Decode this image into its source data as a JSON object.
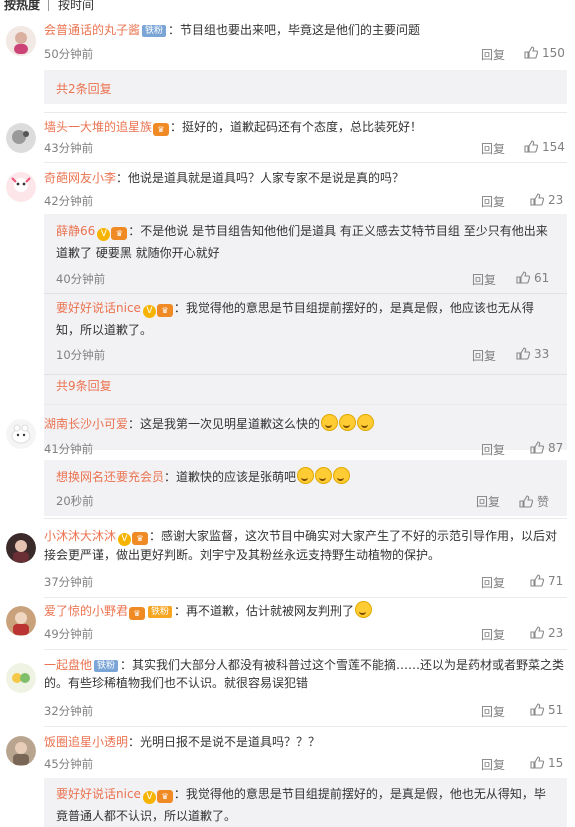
{
  "tabs": [
    "按热度",
    "按时间"
  ],
  "labels": {
    "reply": "回复",
    "like_zero": "赞"
  },
  "comments": [
    {
      "name": "会普通话的丸子酱",
      "badge": "铁粉",
      "text": "：节目组也要出来吧，毕竟这是他们的主要问题",
      "time": "50分钟前",
      "likes": "150",
      "more": "共2条回复"
    },
    {
      "name": "墙头一大堆的追星族",
      "text": "：挺好的，道歉起码还有个态度，总比装死好！",
      "time": "43分钟前",
      "likes": "154"
    },
    {
      "name": "奇葩网友小李",
      "text": "：他说是道具就是道具吗？人家专家不是说是真的吗？",
      "time": "42分钟前",
      "likes": "23",
      "subs": [
        {
          "name": "薛静66",
          "text": "：不是他说 是节目组告知他他们是道具 有正义感去艾特节目组 至少只有他出来道歉了 硬要黑 就随你开心就好",
          "time": "40分钟前",
          "likes": "61"
        },
        {
          "name": "要好好说话nice",
          "text": "：我觉得他的意思是节目组提前摆好的，是真是假，他应该也无从得知，所以道歉了。",
          "time": "10分钟前",
          "likes": "33"
        }
      ],
      "more": "共9条回复"
    },
    {
      "name": "湖南长沙小可爱",
      "text": "：这是我第一次见明星道歉这么快的",
      "time": "41分钟前",
      "likes": "87",
      "subs": [
        {
          "name": "想换网名还要充会员",
          "text": "：道歉快的应该是张萌吧",
          "time": "20秒前",
          "likes": "赞"
        }
      ]
    },
    {
      "name": "小沐沐大沐沐",
      "text": "：感谢大家监督，这次节目中确实对大家产生了不好的示范引导作用，以后对接会更严谨，做出更好判断。刘宇宁及其粉丝永远支持野生动植物的保护。",
      "time": "37分钟前",
      "likes": "71"
    },
    {
      "name": "爱了惊的小野君",
      "badge": "铁粉",
      "text": "：再不道歉，估计就被网友判刑了",
      "time": "49分钟前",
      "likes": "23"
    },
    {
      "name": "一起盘他",
      "badge": "铁粉",
      "text": "：其实我们大部分人都没有被科普过这个雪莲不能摘……还以为是药材或者野菜之类的。有些珍稀植物我们也不认识。就很容易误犯错",
      "time": "32分钟前",
      "likes": "51"
    },
    {
      "name": "饭圈追星小透明",
      "text": "：光明日报不是说不是道具吗？？？",
      "time": "45分钟前",
      "likes": "15",
      "subs": [
        {
          "name": "要好好说话nice",
          "text": "：我觉得他的意思是节目组提前摆好的，是真是假，他也无从得知，毕竟普通人都不认识，所以道歉了。",
          "time": "",
          "likes": ""
        }
      ]
    }
  ]
}
